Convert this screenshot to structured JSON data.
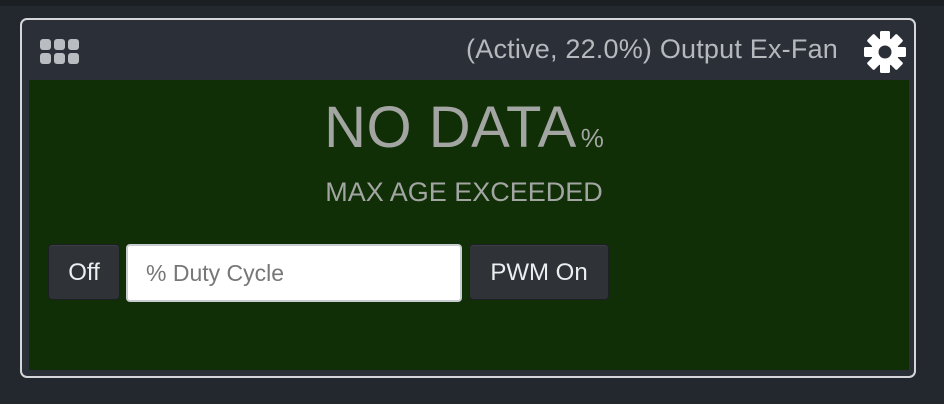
{
  "widget": {
    "title": "(Active, 22.0%) Output Ex-Fan",
    "value": "NO DATA",
    "unit": "%",
    "status": "MAX AGE EXCEEDED",
    "off_button_label": "Off",
    "duty_input": {
      "value": "",
      "placeholder": "% Duty Cycle"
    },
    "pwm_button_label": "PWM On",
    "icons": {
      "drag_handle": "grid-icon",
      "settings": "gear-icon"
    },
    "colors": {
      "panel_background": "#102f06",
      "widget_border": "#d4d6d9",
      "header_background": "#2b3038",
      "page_background": "#23272e"
    }
  }
}
